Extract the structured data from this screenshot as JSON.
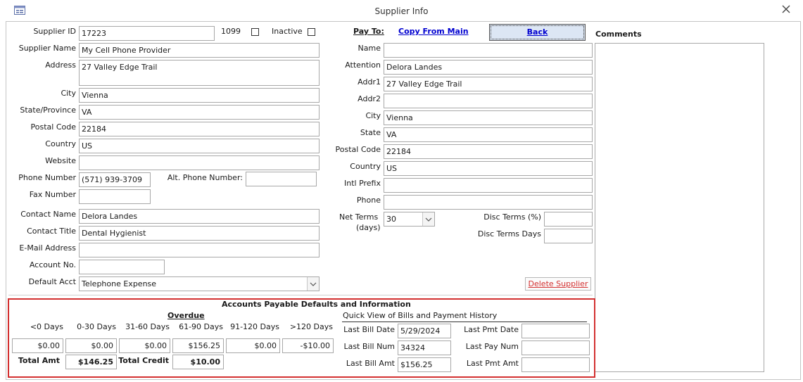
{
  "window": {
    "title": "Supplier Info",
    "app_icon": "form-icon",
    "close_icon": "close-icon"
  },
  "supplier": {
    "id_label": "Supplier ID",
    "id_value": "17223",
    "form1099_label": "1099",
    "inactive_label": "Inactive",
    "name_label": "Supplier Name",
    "name_value": "My Cell Phone Provider",
    "address_label": "Address",
    "address_value": "27 Valley Edge Trail",
    "city_label": "City",
    "city_value": "Vienna",
    "state_label": "State/Province",
    "state_value": "VA",
    "postal_label": "Postal Code",
    "postal_value": "22184",
    "country_label": "Country",
    "country_value": "US",
    "website_label": "Website",
    "website_value": "",
    "phone_label": "Phone Number",
    "phone_value": "(571) 939-3709",
    "alt_phone_label": "Alt. Phone Number:",
    "alt_phone_value": "",
    "fax_label": "Fax Number",
    "fax_value": "",
    "contact_name_label": "Contact Name",
    "contact_name_value": "Delora Landes",
    "contact_title_label": "Contact Title",
    "contact_title_value": "Dental Hygienist",
    "email_label": "E-Mail Address",
    "email_value": "",
    "account_label": "Account No.",
    "account_value": "",
    "default_acct_label": "Default Acct",
    "default_acct_value": "Telephone Expense"
  },
  "payto": {
    "label": "Pay To:",
    "copy_link": "Copy From Main",
    "back_button": "Back",
    "name_label": "Name",
    "name_value": "",
    "attention_label": "Attention",
    "attention_value": "Delora Landes",
    "addr1_label": "Addr1",
    "addr1_value": "27 Valley Edge Trail",
    "addr2_label": "Addr2",
    "addr2_value": "",
    "city_label": "City",
    "city_value": "Vienna",
    "state_label": "State",
    "state_value": "VA",
    "postal_label": "Postal Code",
    "postal_value": "22184",
    "country_label": "Country",
    "country_value": "US",
    "intl_label": "Intl Prefix",
    "intl_value": "",
    "phone_label": "Phone",
    "phone_value": "",
    "net_terms_label": "Net Terms",
    "net_terms_sub": "(days)",
    "net_terms_value": "30",
    "disc_terms_label": "Disc Terms (%)",
    "disc_terms_value": "",
    "disc_days_label": "Disc Terms Days",
    "disc_days_value": "",
    "delete_button": "Delete Supplier"
  },
  "comments": {
    "label": "Comments",
    "value": ""
  },
  "ap": {
    "title": "Accounts Payable Defaults and Information",
    "overdue_label": "Overdue",
    "buckets": [
      {
        "label": "<0 Days",
        "value": "$0.00"
      },
      {
        "label": "0-30 Days",
        "value": "$0.00"
      },
      {
        "label": "31-60 Days",
        "value": "$0.00"
      },
      {
        "label": "61-90 Days",
        "value": "$156.25"
      },
      {
        "label": "91-120 Days",
        "value": "$0.00"
      },
      {
        "label": ">120 Days",
        "value": "-$10.00"
      }
    ],
    "total_amt_label": "Total Amt",
    "total_amt_value": "$146.25",
    "total_credit_label": "Total Credit",
    "total_credit_value": "$10.00",
    "quick_view_label": "Quick View of Bills and Payment History",
    "last_bill_date_label": "Last Bill Date",
    "last_bill_date_value": "5/29/2024",
    "last_bill_num_label": "Last Bill Num",
    "last_bill_num_value": "34324",
    "last_bill_amt_label": "Last Bill Amt",
    "last_bill_amt_value": "$156.25",
    "last_pmt_date_label": "Last Pmt Date",
    "last_pmt_date_value": "",
    "last_pay_num_label": "Last Pay Num",
    "last_pay_num_value": "",
    "last_pmt_amt_label": "Last Pmt Amt",
    "last_pmt_amt_value": ""
  },
  "colors": {
    "accent_red": "#d33030",
    "link_blue": "#0000d0",
    "back_bg": "#dce6f4"
  }
}
